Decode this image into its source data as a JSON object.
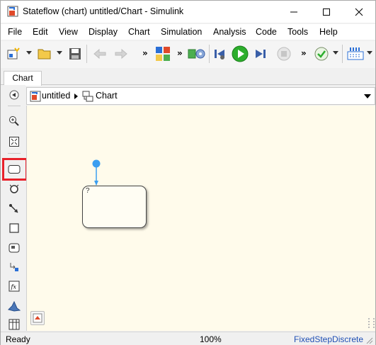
{
  "window": {
    "title": "Stateflow (chart) untitled/Chart - Simulink"
  },
  "menu": {
    "items": [
      "File",
      "Edit",
      "View",
      "Display",
      "Chart",
      "Simulation",
      "Analysis",
      "Code",
      "Tools",
      "Help"
    ]
  },
  "tabs": {
    "active": "Chart"
  },
  "breadcrumb": {
    "model": "untitled",
    "chart": "Chart"
  },
  "canvas": {
    "state_label": "?"
  },
  "status": {
    "left": "Ready",
    "zoom": "100%",
    "solver": "FixedStepDiscrete"
  },
  "colors": {
    "canvas_bg": "#fffbeb",
    "highlight": "#e8212a",
    "transition": "#3b9ef0",
    "run_green": "#2dae2d",
    "solver_link": "#1f4fb4"
  }
}
